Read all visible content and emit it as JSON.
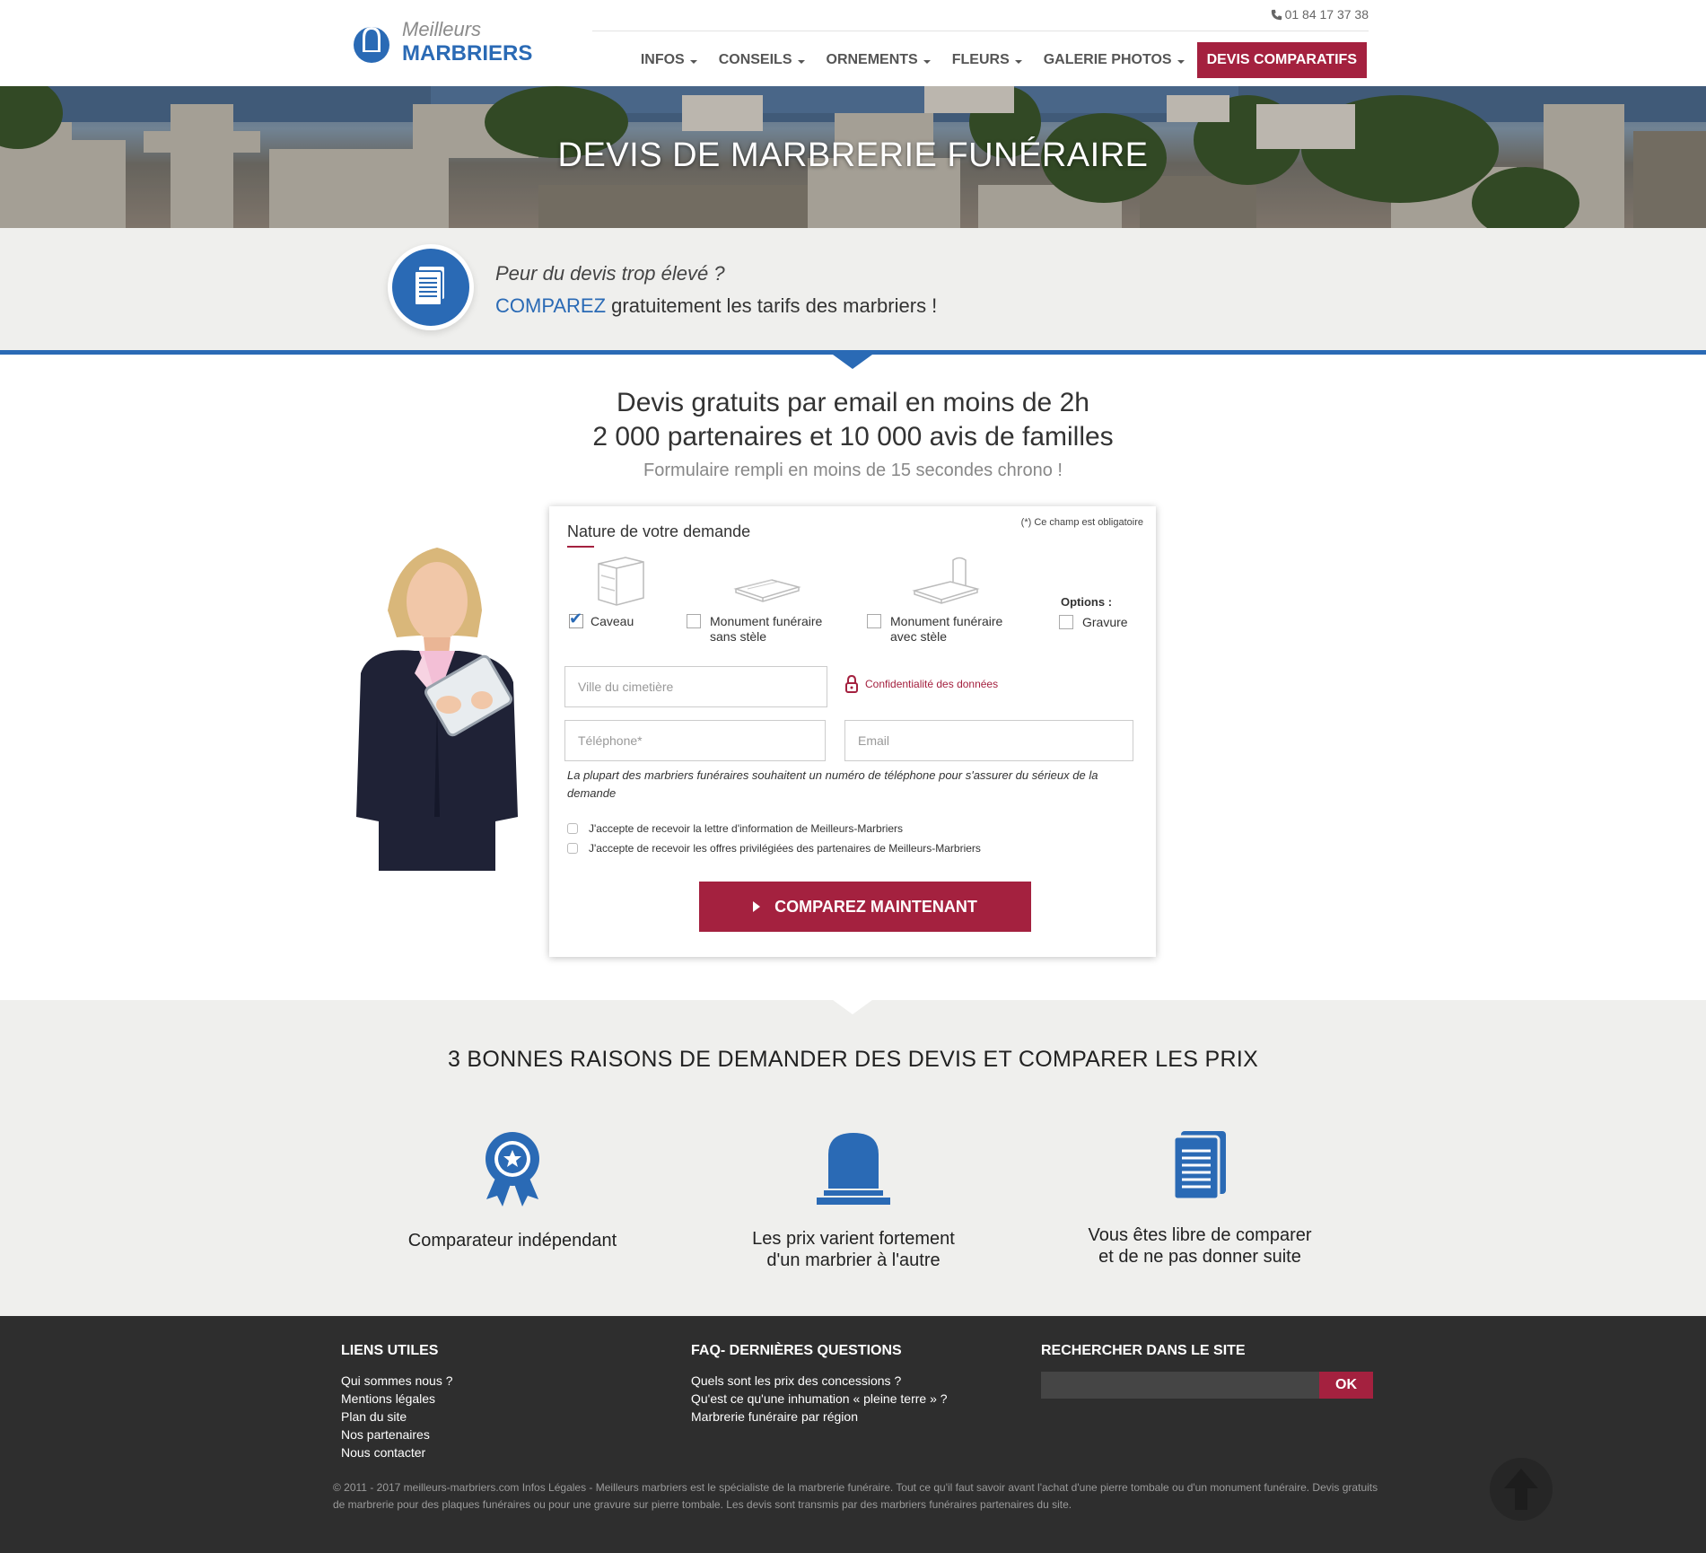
{
  "header": {
    "logo_line1": "Meilleurs",
    "logo_line2": "MARBRIERS",
    "phone": "01 84 17 37 38",
    "nav": [
      {
        "label": "INFOS"
      },
      {
        "label": "CONSEILS"
      },
      {
        "label": "ORNEMENTS"
      },
      {
        "label": "FLEURS"
      },
      {
        "label": "GALERIE PHOTOS"
      }
    ],
    "cta_label": "DEVIS COMPARATIFS"
  },
  "hero": {
    "title": "DEVIS DE MARBRERIE FUNÉRAIRE"
  },
  "banner": {
    "question": "Peur du devis trop élevé ?",
    "highlight": "COMPAREZ",
    "rest": " gratuitement les tarifs des marbriers !"
  },
  "intro": {
    "line1": "Devis gratuits par email en moins de 2h",
    "line2": "2 000 partenaires et 10 000 avis de familles",
    "line3": "Formulaire rempli en moins de 15 secondes chrono !"
  },
  "form": {
    "title": "Nature de votre demande",
    "required_note": "(*) Ce champ est obligatoire",
    "options_label": "Options :",
    "choices": [
      {
        "label": "Caveau",
        "checked": true
      },
      {
        "label": "Monument funéraire sans stèle",
        "checked": false
      },
      {
        "label": "Monument funéraire avec stèle",
        "checked": false
      },
      {
        "label": "Gravure",
        "checked": false
      }
    ],
    "city_placeholder": "Ville du cimetière",
    "privacy_label": "Confidentialité des données",
    "phone_placeholder": "Téléphone*",
    "email_placeholder": "Email",
    "note": "La plupart des marbriers funéraires souhaitent un numéro de téléphone pour s'assurer du sérieux de la demande",
    "consent1": "J'accepte de recevoir la lettre d'information de Meilleurs-Marbriers",
    "consent2": "J'accepte de recevoir les offres privilégiées des partenaires de Meilleurs-Marbriers",
    "submit_label": "COMPAREZ MAINTENANT"
  },
  "reasons": {
    "title": "3 BONNES RAISONS DE DEMANDER DES DEVIS ET COMPARER LES PRIX",
    "items": [
      {
        "line1": "Comparateur indépendant",
        "line2": "",
        "icon": "award-ribbon-icon"
      },
      {
        "line1": "Les prix varient fortement",
        "line2": "d'un marbrier à l'autre",
        "icon": "tombstone-icon"
      },
      {
        "line1": "Vous êtes libre de comparer",
        "line2": "et de ne pas donner suite",
        "icon": "documents-icon"
      }
    ]
  },
  "footer": {
    "col1_title": "LIENS UTILES",
    "col1_links": [
      "Qui sommes nous ?",
      "Mentions légales",
      "Plan du site",
      "Nos partenaires",
      "Nous contacter"
    ],
    "col2_title": "FAQ- DERNIÈRES QUESTIONS",
    "col2_links": [
      "Quels sont les prix des concessions ?",
      "Qu'est ce qu'une inhumation « pleine terre » ?",
      "Marbrerie funéraire par région"
    ],
    "col3_title": "RECHERCHER DANS LE SITE",
    "search_button": "OK",
    "copyright": "© 2011 - 2017 meilleurs-marbriers.com Infos Légales - Meilleurs marbriers est le spécialiste de la marbrerie funéraire. Tout ce qu'il faut savoir avant l'achat d'une pierre tombale ou d'un monument funéraire. Devis gratuits de marbrerie pour des plaques funéraires ou pour une gravure sur pierre tombale. Les devis sont transmis par des marbriers funéraires partenaires du site."
  },
  "colors": {
    "brand_blue": "#2a6ab5",
    "brand_red": "#a4213f",
    "footer_bg": "#2e2e2e",
    "band_bg": "#efefed"
  }
}
